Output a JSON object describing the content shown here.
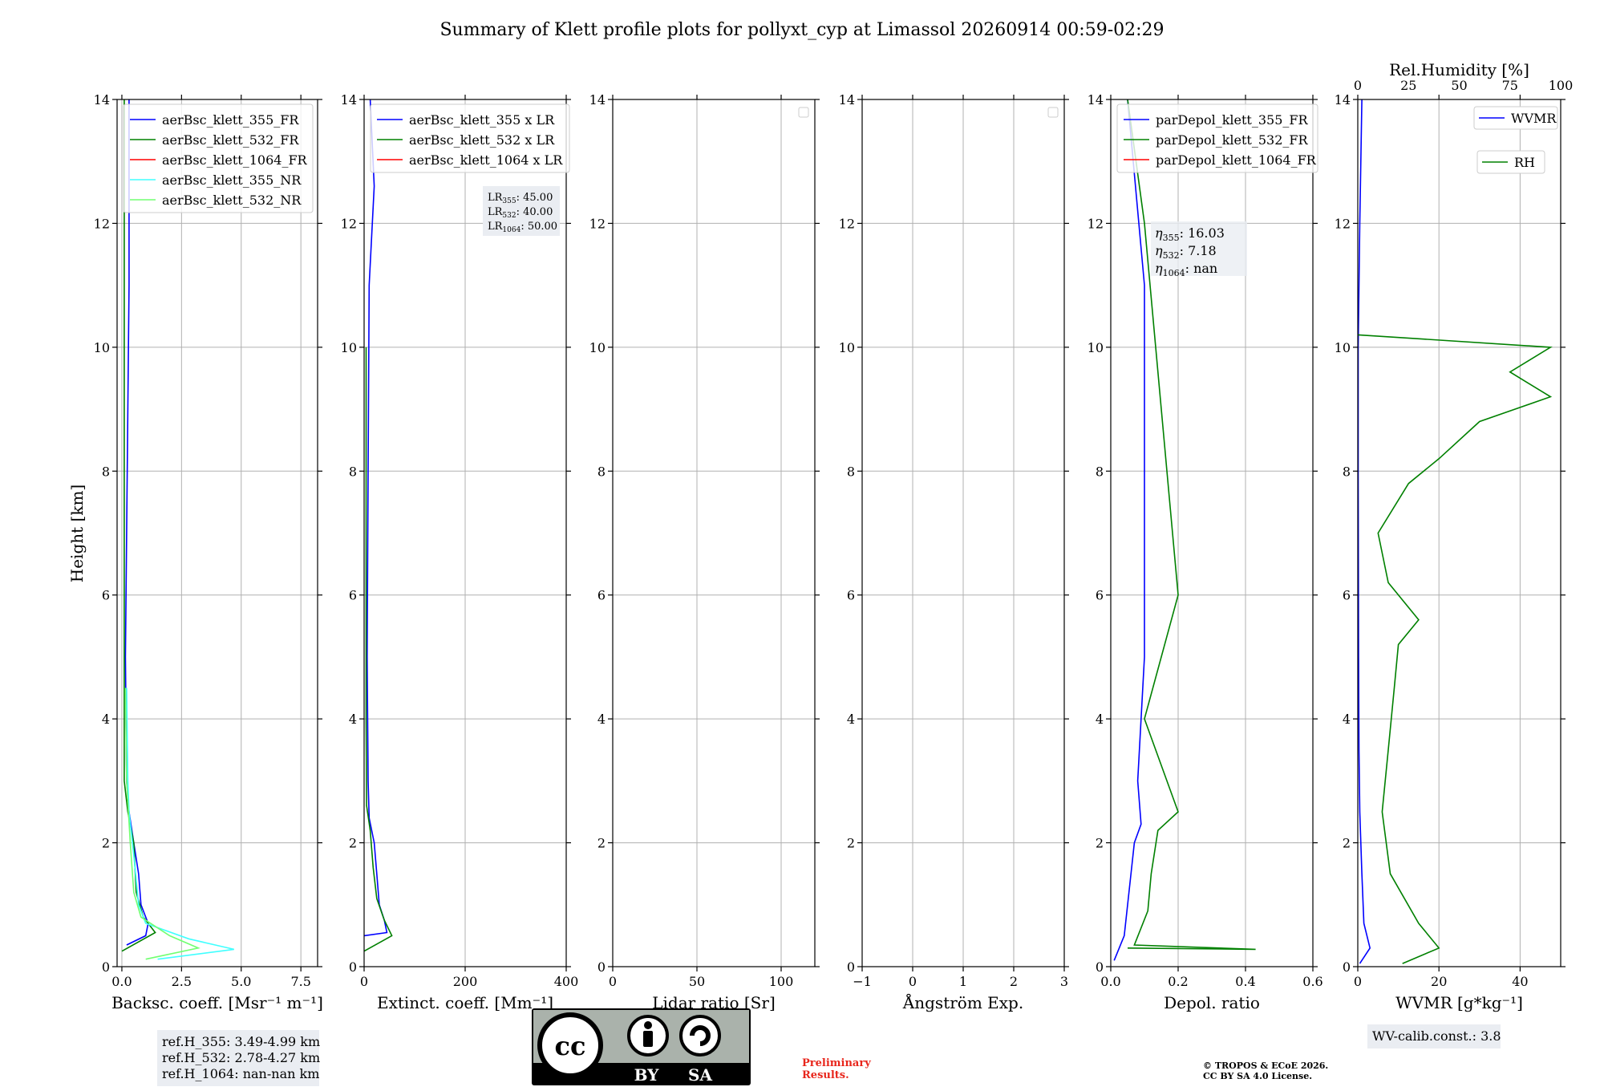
{
  "title": "Summary of Klett profile plots for pollyxt_cyp at Limassol 20260914 00:59-02:29",
  "ylabel": "Height [km]",
  "yticks": [
    "0",
    "2",
    "4",
    "6",
    "8",
    "10",
    "12",
    "14"
  ],
  "panels": [
    {
      "xlabel_html": "Backsc. coeff. [Msr⁻¹ m⁻¹]",
      "xticks": [
        "0.0",
        "2.5",
        "5.0",
        "7.5"
      ],
      "legend": [
        "aerBsc_klett_355_FR",
        "aerBsc_klett_532_FR",
        "aerBsc_klett_1064_FR",
        "aerBsc_klett_355_NR",
        "aerBsc_klett_532_NR"
      ],
      "info": [
        "ref.H_355: 3.49-4.99 km",
        "ref.H_532: 2.78-4.27 km",
        "ref.H_1064: nan-nan km"
      ]
    },
    {
      "xlabel_html": "Extinct. coeff. [Mm⁻¹]",
      "xticks": [
        "0",
        "200",
        "400"
      ],
      "legend": [
        "aerBsc_klett_355 x LR",
        "aerBsc_klett_532 x LR",
        "aerBsc_klett_1064 x LR"
      ],
      "lr": [
        {
          "sub": "355",
          "val": ": 45.00"
        },
        {
          "sub": "532",
          "val": ": 40.00"
        },
        {
          "sub": "1064",
          "val": ": 50.00"
        }
      ]
    },
    {
      "xlabel_html": "Lidar ratio [Sr]",
      "xticks": [
        "0",
        "50",
        "100"
      ]
    },
    {
      "xlabel_html": "Ångström Exp.",
      "xticks": [
        "−1",
        "0",
        "1",
        "2",
        "3"
      ]
    },
    {
      "xlabel_html": "Depol. ratio",
      "xticks": [
        "0.0",
        "0.2",
        "0.4",
        "0.6"
      ],
      "legend": [
        "parDepol_klett_355_FR",
        "parDepol_klett_532_FR",
        "parDepol_klett_1064_FR"
      ],
      "eta": [
        {
          "sub": "355",
          "val": ": 16.03"
        },
        {
          "sub": "532",
          "val": ": 7.18"
        },
        {
          "sub": "1064",
          "val": ": nan"
        }
      ]
    },
    {
      "xlabel_html": "WVMR [g*kg⁻¹]",
      "xticks": [
        "0",
        "20",
        "40"
      ],
      "top_label": "Rel.Humidity [%]",
      "top_ticks": [
        "0",
        "25",
        "50",
        "75",
        "100"
      ],
      "legend": [
        "WVMR",
        "RH"
      ],
      "info": [
        "WV-calib.const.: 3.8"
      ]
    }
  ],
  "chart_data": [
    {
      "type": "line",
      "title": "",
      "xlabel": "Backsc. coeff. [Msr-1 m-1]",
      "ylabel": "Height [km]",
      "xlim": [
        -0.2,
        8.2
      ],
      "ylim": [
        0,
        14
      ],
      "series": [
        {
          "name": "aerBsc_klett_355_FR",
          "color": "#0000ff",
          "points": [
            [
              0.2,
              0.35
            ],
            [
              1.0,
              0.5
            ],
            [
              1.1,
              0.7
            ],
            [
              0.8,
              1.0
            ],
            [
              0.7,
              1.5
            ],
            [
              0.5,
              2.0
            ],
            [
              0.3,
              2.5
            ],
            [
              0.2,
              3
            ],
            [
              0.15,
              5
            ],
            [
              0.2,
              7
            ],
            [
              0.25,
              9
            ],
            [
              0.3,
              11
            ],
            [
              0.3,
              13
            ],
            [
              0.3,
              14
            ]
          ]
        },
        {
          "name": "aerBsc_klett_532_FR",
          "color": "#008000",
          "points": [
            [
              0.0,
              0.25
            ],
            [
              1.4,
              0.55
            ],
            [
              0.9,
              0.8
            ],
            [
              0.6,
              1.2
            ],
            [
              0.5,
              2.0
            ],
            [
              0.25,
              2.5
            ],
            [
              0.1,
              3
            ],
            [
              0.1,
              6
            ],
            [
              0.1,
              10
            ],
            [
              0.1,
              14
            ]
          ]
        },
        {
          "name": "aerBsc_klett_1064_FR",
          "color": "#ff0000",
          "points": []
        },
        {
          "name": "aerBsc_klett_355_NR",
          "color": "#40ffff",
          "points": [
            [
              1.5,
              0.12
            ],
            [
              4.7,
              0.28
            ],
            [
              2.8,
              0.45
            ],
            [
              1.0,
              0.7
            ],
            [
              0.7,
              1.0
            ],
            [
              0.5,
              1.8
            ],
            [
              0.3,
              2.5
            ],
            [
              0.25,
              3
            ],
            [
              0.2,
              4.5
            ]
          ]
        },
        {
          "name": "aerBsc_klett_532_NR",
          "color": "#70ff70",
          "points": [
            [
              1.0,
              0.12
            ],
            [
              3.2,
              0.3
            ],
            [
              2.0,
              0.5
            ],
            [
              0.8,
              0.8
            ],
            [
              0.5,
              1.2
            ],
            [
              0.35,
              2.0
            ],
            [
              0.2,
              3
            ],
            [
              0.15,
              4.5
            ]
          ]
        }
      ]
    },
    {
      "type": "line",
      "title": "",
      "xlabel": "Extinct. coeff. [Mm-1]",
      "ylabel": "",
      "xlim": [
        0,
        400
      ],
      "ylim": [
        0,
        14
      ],
      "series": [
        {
          "name": "aerBsc_klett_355 x LR",
          "color": "#0000ff",
          "points": [
            [
              0,
              0.5
            ],
            [
              45,
              0.55
            ],
            [
              40,
              0.75
            ],
            [
              30,
              1.0
            ],
            [
              25,
              1.5
            ],
            [
              20,
              2.0
            ],
            [
              10,
              2.4
            ],
            [
              8,
              3
            ],
            [
              6,
              5
            ],
            [
              8,
              8
            ],
            [
              10,
              11
            ],
            [
              20,
              12.6
            ],
            [
              12,
              14
            ]
          ]
        },
        {
          "name": "aerBsc_klett_532 x LR",
          "color": "#008000",
          "points": [
            [
              0,
              0.25
            ],
            [
              55,
              0.5
            ],
            [
              40,
              0.75
            ],
            [
              25,
              1.1
            ],
            [
              18,
              1.6
            ],
            [
              12,
              2.2
            ],
            [
              5,
              2.6
            ],
            [
              4,
              4
            ],
            [
              4,
              10
            ]
          ]
        },
        {
          "name": "aerBsc_klett_1064 x LR",
          "color": "#ff0000",
          "points": []
        }
      ]
    },
    {
      "type": "line",
      "title": "",
      "xlabel": "Lidar ratio [Sr]",
      "ylabel": "",
      "xlim": [
        0,
        120
      ],
      "ylim": [
        0,
        14
      ],
      "series": []
    },
    {
      "type": "line",
      "title": "",
      "xlabel": "Ångström Exp.",
      "ylabel": "",
      "xlim": [
        -1,
        3
      ],
      "ylim": [
        0,
        14
      ],
      "series": []
    },
    {
      "type": "line",
      "title": "",
      "xlabel": "Depol. ratio",
      "ylabel": "",
      "xlim": [
        0,
        0.6
      ],
      "ylim": [
        0,
        14
      ],
      "series": [
        {
          "name": "parDepol_klett_355_FR",
          "color": "#0000ff",
          "points": [
            [
              0.01,
              0.1
            ],
            [
              0.04,
              0.5
            ],
            [
              0.05,
              1.0
            ],
            [
              0.06,
              1.5
            ],
            [
              0.07,
              2.0
            ],
            [
              0.09,
              2.3
            ],
            [
              0.08,
              3
            ],
            [
              0.1,
              5
            ],
            [
              0.1,
              8
            ],
            [
              0.1,
              11
            ],
            [
              0.05,
              14
            ]
          ]
        },
        {
          "name": "parDepol_klett_532_FR",
          "color": "#008000",
          "points": [
            [
              0.05,
              0.3
            ],
            [
              0.43,
              0.28
            ],
            [
              0.07,
              0.35
            ],
            [
              0.11,
              0.9
            ],
            [
              0.12,
              1.5
            ],
            [
              0.14,
              2.2
            ],
            [
              0.2,
              2.5
            ],
            [
              0.1,
              4
            ],
            [
              0.2,
              6
            ],
            [
              0.15,
              9
            ],
            [
              0.1,
              12
            ],
            [
              0.05,
              14
            ]
          ]
        },
        {
          "name": "parDepol_klett_1064_FR",
          "color": "#ff0000",
          "points": []
        }
      ]
    },
    {
      "type": "line",
      "title": "",
      "xlabel": "WVMR [g*kg-1]",
      "ylabel": "",
      "xlim": [
        0,
        50
      ],
      "ylim": [
        0,
        14
      ],
      "top_axis": {
        "label": "Rel.Humidity [%]",
        "lim": [
          0,
          100
        ]
      },
      "series": [
        {
          "name": "WVMR",
          "color": "#0000ff",
          "points": [
            [
              0.5,
              0.05
            ],
            [
              3,
              0.3
            ],
            [
              1.5,
              0.7
            ],
            [
              1.0,
              1.5
            ],
            [
              0.5,
              2.5
            ],
            [
              0.3,
              3.5
            ],
            [
              0.2,
              5
            ],
            [
              0.1,
              8
            ],
            [
              0.1,
              10
            ],
            [
              0.5,
              12
            ],
            [
              1.0,
              14
            ]
          ]
        },
        {
          "name": "RH",
          "color": "#008000",
          "points": [
            [
              22,
              0.05
            ],
            [
              40,
              0.3
            ],
            [
              30,
              0.7
            ],
            [
              16,
              1.5
            ],
            [
              12,
              2.5
            ],
            [
              15,
              3.5
            ],
            [
              18,
              4.5
            ],
            [
              20,
              5.2
            ],
            [
              30,
              5.6
            ],
            [
              15,
              6.2
            ],
            [
              10,
              7
            ],
            [
              25,
              7.8
            ],
            [
              40,
              8.2
            ],
            [
              60,
              8.8
            ],
            [
              95,
              9.2
            ],
            [
              75,
              9.6
            ],
            [
              95,
              10
            ],
            [
              0,
              10.2
            ]
          ],
          "axis": "top"
        }
      ]
    }
  ]
}
